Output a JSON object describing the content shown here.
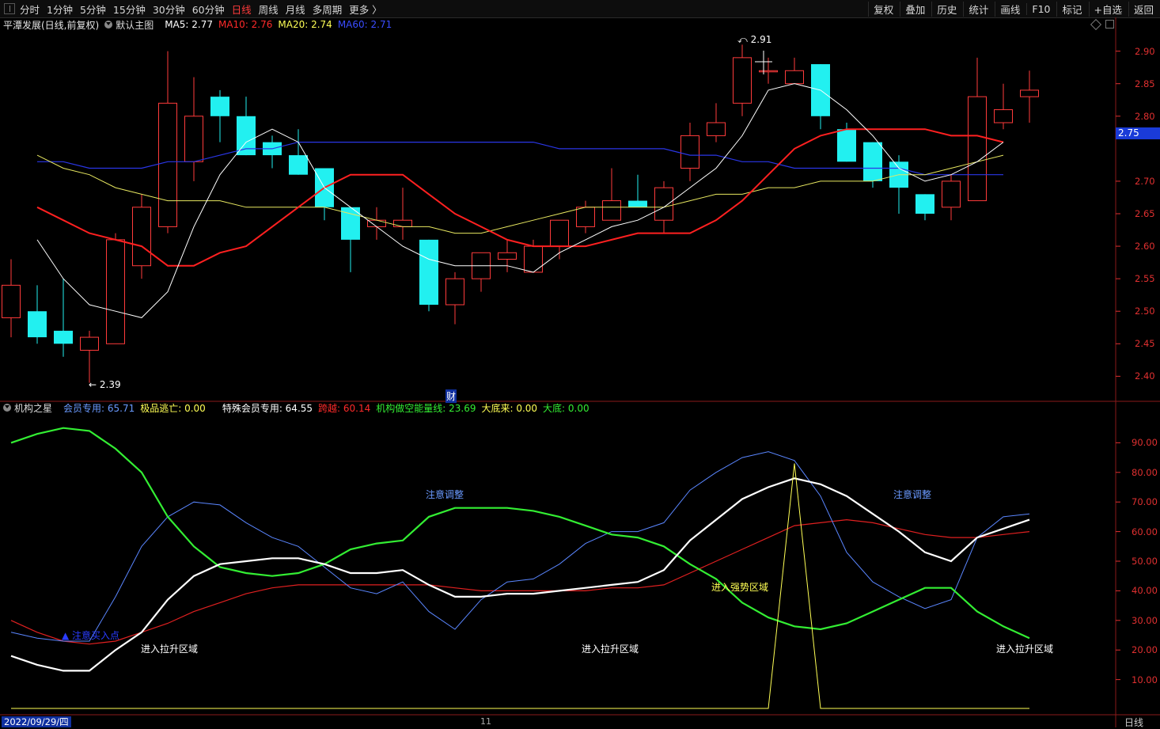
{
  "toolbar": {
    "periods": [
      "分时",
      "1分钟",
      "5分钟",
      "15分钟",
      "30分钟",
      "60分钟",
      "日线",
      "周线",
      "月线",
      "多周期",
      "更多 〉"
    ],
    "active_index": 6,
    "right_items": [
      "复权",
      "叠加",
      "历史",
      "统计",
      "画线",
      "F10",
      "标记",
      "+自选",
      "返回"
    ]
  },
  "main": {
    "title": "平潭发展(日线,前复权)",
    "template": "默认主图",
    "ma": [
      {
        "label": "MA5: 2.77",
        "color": "#ffffff"
      },
      {
        "label": "MA10: 2.76",
        "color": "#ff2a2a"
      },
      {
        "label": "MA20: 2.74",
        "color": "#ffff55"
      },
      {
        "label": "MA60: 2.71",
        "color": "#3a4cff"
      }
    ],
    "y_ticks": [
      "2.90",
      "2.85",
      "2.80",
      "2.75",
      "2.70",
      "2.65",
      "2.60",
      "2.55",
      "2.50",
      "2.45",
      "2.40"
    ],
    "price_badge": "2.75",
    "high_label": "2.91",
    "low_label": "2.39",
    "cai_label": "财"
  },
  "indicator": {
    "name": "机构之星",
    "fields": [
      {
        "label": "会员专用: 65.71",
        "color": "#6a9aff"
      },
      {
        "label": "极品逃亡: 0.00",
        "color": "#ffff55"
      },
      {
        "label": "特殊会员专用: 64.55",
        "color": "#ffffff"
      },
      {
        "label": "跨越: 60.14",
        "color": "#ff2a2a"
      },
      {
        "label": "机构做空能量线: 23.69",
        "color": "#33ee33"
      },
      {
        "label": "大底来: 0.00",
        "color": "#ffff55"
      },
      {
        "label": "大底: 0.00",
        "color": "#33ee33"
      }
    ],
    "y_ticks": [
      "90.00",
      "80.00",
      "70.00",
      "60.00",
      "50.00",
      "40.00",
      "30.00",
      "20.00",
      "10.00"
    ],
    "annotations": {
      "note_adjust_1": "注意调整",
      "note_adjust_2": "注意调整",
      "strong_zone": "进入强势区域",
      "rise_zone_1": "进入拉升区域",
      "rise_zone_2": "进入拉升区域",
      "rise_zone_3": "进入拉升区域",
      "buy_point": "注意买入点"
    }
  },
  "footer": {
    "date": "2022/09/29/四",
    "month_mark": "11",
    "period": "日线"
  },
  "chart_data": {
    "type": "candlestick",
    "price_ylim": [
      2.37,
      2.93
    ],
    "candles": [
      {
        "o": 2.49,
        "h": 2.58,
        "l": 2.46,
        "c": 2.54
      },
      {
        "o": 2.5,
        "h": 2.54,
        "l": 2.45,
        "c": 2.46
      },
      {
        "o": 2.47,
        "h": 2.55,
        "l": 2.43,
        "c": 2.45
      },
      {
        "o": 2.44,
        "h": 2.47,
        "l": 2.39,
        "c": 2.46
      },
      {
        "o": 2.45,
        "h": 2.62,
        "l": 2.45,
        "c": 2.61
      },
      {
        "o": 2.57,
        "h": 2.68,
        "l": 2.55,
        "c": 2.66
      },
      {
        "o": 2.63,
        "h": 2.9,
        "l": 2.62,
        "c": 2.82
      },
      {
        "o": 2.73,
        "h": 2.86,
        "l": 2.7,
        "c": 2.8
      },
      {
        "o": 2.83,
        "h": 2.84,
        "l": 2.76,
        "c": 2.8
      },
      {
        "o": 2.8,
        "h": 2.83,
        "l": 2.74,
        "c": 2.74
      },
      {
        "o": 2.76,
        "h": 2.77,
        "l": 2.72,
        "c": 2.74
      },
      {
        "o": 2.74,
        "h": 2.78,
        "l": 2.71,
        "c": 2.71
      },
      {
        "o": 2.72,
        "h": 2.72,
        "l": 2.64,
        "c": 2.66
      },
      {
        "o": 2.66,
        "h": 2.66,
        "l": 2.56,
        "c": 2.61
      },
      {
        "o": 2.63,
        "h": 2.66,
        "l": 2.61,
        "c": 2.64
      },
      {
        "o": 2.63,
        "h": 2.69,
        "l": 2.61,
        "c": 2.64
      },
      {
        "o": 2.61,
        "h": 2.61,
        "l": 2.5,
        "c": 2.51
      },
      {
        "o": 2.51,
        "h": 2.56,
        "l": 2.48,
        "c": 2.55
      },
      {
        "o": 2.55,
        "h": 2.59,
        "l": 2.53,
        "c": 2.59
      },
      {
        "o": 2.58,
        "h": 2.61,
        "l": 2.56,
        "c": 2.59
      },
      {
        "o": 2.56,
        "h": 2.61,
        "l": 2.56,
        "c": 2.6
      },
      {
        "o": 2.6,
        "h": 2.64,
        "l": 2.58,
        "c": 2.64
      },
      {
        "o": 2.63,
        "h": 2.67,
        "l": 2.62,
        "c": 2.66
      },
      {
        "o": 2.64,
        "h": 2.72,
        "l": 2.64,
        "c": 2.67
      },
      {
        "o": 2.67,
        "h": 2.71,
        "l": 2.66,
        "c": 2.66
      },
      {
        "o": 2.64,
        "h": 2.7,
        "l": 2.62,
        "c": 2.69
      },
      {
        "o": 2.72,
        "h": 2.79,
        "l": 2.7,
        "c": 2.77
      },
      {
        "o": 2.77,
        "h": 2.82,
        "l": 2.76,
        "c": 2.79
      },
      {
        "o": 2.82,
        "h": 2.91,
        "l": 2.8,
        "c": 2.89
      },
      {
        "o": 2.87,
        "h": 2.89,
        "l": 2.85,
        "c": 2.87
      },
      {
        "o": 2.85,
        "h": 2.89,
        "l": 2.85,
        "c": 2.87
      },
      {
        "o": 2.88,
        "h": 2.88,
        "l": 2.78,
        "c": 2.8
      },
      {
        "o": 2.78,
        "h": 2.79,
        "l": 2.73,
        "c": 2.73
      },
      {
        "o": 2.76,
        "h": 2.76,
        "l": 2.69,
        "c": 2.7
      },
      {
        "o": 2.73,
        "h": 2.74,
        "l": 2.65,
        "c": 2.69
      },
      {
        "o": 2.68,
        "h": 2.68,
        "l": 2.64,
        "c": 2.65
      },
      {
        "o": 2.66,
        "h": 2.71,
        "l": 2.64,
        "c": 2.7
      },
      {
        "o": 2.67,
        "h": 2.89,
        "l": 2.68,
        "c": 2.83
      },
      {
        "o": 2.79,
        "h": 2.85,
        "l": 2.78,
        "c": 2.81
      },
      {
        "o": 2.83,
        "h": 2.87,
        "l": 2.79,
        "c": 2.84
      }
    ],
    "ma5": [
      2.61,
      2.55,
      2.51,
      2.5,
      2.49,
      2.53,
      2.63,
      2.71,
      2.76,
      2.78,
      2.76,
      2.69,
      2.66,
      2.63,
      2.6,
      2.58,
      2.57,
      2.57,
      2.57,
      2.56,
      2.59,
      2.61,
      2.63,
      2.64,
      2.66,
      2.69,
      2.72,
      2.77,
      2.84,
      2.85,
      2.84,
      2.81,
      2.77,
      2.72,
      2.7,
      2.71,
      2.73,
      2.76
    ],
    "ma10": [
      2.66,
      2.64,
      2.62,
      2.61,
      2.6,
      2.57,
      2.57,
      2.59,
      2.6,
      2.63,
      2.66,
      2.69,
      2.71,
      2.71,
      2.71,
      2.68,
      2.65,
      2.63,
      2.61,
      2.6,
      2.6,
      2.6,
      2.61,
      2.62,
      2.62,
      2.62,
      2.64,
      2.67,
      2.71,
      2.75,
      2.77,
      2.78,
      2.78,
      2.78,
      2.78,
      2.77,
      2.77,
      2.76
    ],
    "ma20": [
      2.74,
      2.72,
      2.71,
      2.69,
      2.68,
      2.67,
      2.67,
      2.67,
      2.66,
      2.66,
      2.66,
      2.66,
      2.65,
      2.64,
      2.63,
      2.63,
      2.62,
      2.62,
      2.63,
      2.64,
      2.65,
      2.66,
      2.66,
      2.66,
      2.66,
      2.67,
      2.68,
      2.68,
      2.69,
      2.69,
      2.7,
      2.7,
      2.7,
      2.71,
      2.71,
      2.72,
      2.73,
      2.74
    ],
    "ma60": [
      2.73,
      2.73,
      2.72,
      2.72,
      2.72,
      2.73,
      2.73,
      2.74,
      2.75,
      2.75,
      2.76,
      2.76,
      2.76,
      2.76,
      2.76,
      2.76,
      2.76,
      2.76,
      2.76,
      2.76,
      2.75,
      2.75,
      2.75,
      2.75,
      2.75,
      2.74,
      2.74,
      2.73,
      2.73,
      2.72,
      2.72,
      2.72,
      2.72,
      2.72,
      2.71,
      2.71,
      2.71,
      2.71
    ],
    "indicator_ylim": [
      0,
      100
    ],
    "member": [
      26,
      24,
      23,
      23,
      38,
      55,
      65,
      70,
      69,
      63,
      58,
      55,
      48,
      41,
      39,
      43,
      33,
      27,
      37,
      43,
      44,
      49,
      56,
      60,
      60,
      63,
      74,
      80,
      85,
      87,
      84,
      72,
      53,
      43,
      38,
      34,
      37,
      58,
      65,
      66
    ],
    "special": [
      18,
      15,
      13,
      13,
      20,
      26,
      37,
      45,
      49,
      50,
      51,
      51,
      49,
      46,
      46,
      47,
      42,
      38,
      38,
      39,
      39,
      40,
      41,
      42,
      43,
      47,
      57,
      64,
      71,
      75,
      78,
      76,
      72,
      66,
      60,
      53,
      50,
      58,
      61,
      64
    ],
    "cross": [
      30,
      26,
      23,
      22,
      23,
      26,
      29,
      33,
      36,
      39,
      41,
      42,
      42,
      42,
      42,
      42,
      42,
      41,
      40,
      40,
      40,
      40,
      40,
      41,
      41,
      42,
      46,
      50,
      54,
      58,
      62,
      63,
      64,
      63,
      61,
      59,
      58,
      58,
      59,
      60
    ],
    "energy": [
      90,
      93,
      95,
      94,
      88,
      80,
      65,
      55,
      48,
      46,
      45,
      46,
      49,
      54,
      56,
      57,
      65,
      68,
      68,
      68,
      67,
      65,
      62,
      59,
      58,
      55,
      49,
      44,
      36,
      31,
      28,
      27,
      29,
      33,
      37,
      41,
      41,
      33,
      28,
      24
    ],
    "escape": [
      0,
      0,
      0,
      0,
      0,
      0,
      0,
      0,
      0,
      0,
      0,
      0,
      0,
      0,
      0,
      0,
      0,
      0,
      0,
      0,
      0,
      0,
      0,
      0,
      0,
      0,
      0,
      0,
      0,
      0,
      83,
      0,
      0,
      0,
      0,
      0,
      0,
      0,
      0,
      0
    ]
  }
}
